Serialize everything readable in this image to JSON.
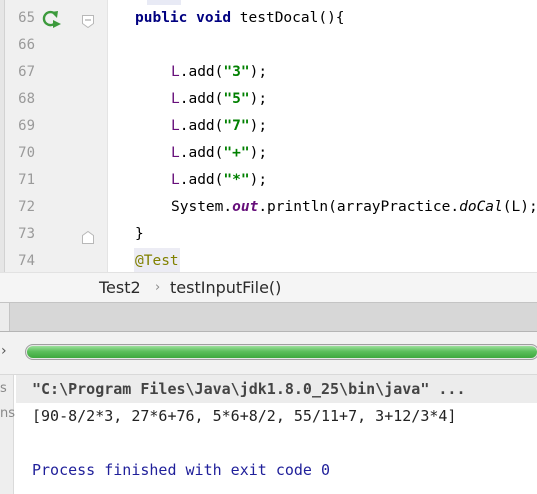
{
  "editor": {
    "lines": [
      {
        "num": "65"
      },
      {
        "num": "66"
      },
      {
        "num": "67"
      },
      {
        "num": "68"
      },
      {
        "num": "69"
      },
      {
        "num": "70"
      },
      {
        "num": "71"
      },
      {
        "num": "72"
      },
      {
        "num": "73"
      },
      {
        "num": "74"
      }
    ],
    "code": {
      "l65": {
        "kw1": "public",
        "kw2": "void",
        "rest": " testDocal(){"
      },
      "l67": {
        "var": "L",
        "call": ".add(",
        "str": "\"3\"",
        "end": ");"
      },
      "l68": {
        "var": "L",
        "call": ".add(",
        "str": "\"5\"",
        "end": ");"
      },
      "l69": {
        "var": "L",
        "call": ".add(",
        "str": "\"7\"",
        "end": ");"
      },
      "l70": {
        "var": "L",
        "call": ".add(",
        "str": "\"+\"",
        "end": ");"
      },
      "l71": {
        "var": "L",
        "call": ".add(",
        "str": "\"*\"",
        "end": ");"
      },
      "l72": {
        "a": "System.",
        "out": "out",
        "b": ".println(arrayPractice.",
        "fn": "doCal",
        "c": "(L);"
      },
      "l73": {
        "text": "}"
      },
      "l74": {
        "text": "@Test"
      }
    },
    "icons": {
      "run_gutter": "run-test-icon",
      "fold": "fold-marker-icon"
    }
  },
  "breadcrumb": {
    "class_name": "Test2",
    "separator": "›",
    "method_name": "testInputFile()"
  },
  "run_panel": {
    "expand_arrow": "›",
    "progress": 1.0,
    "progress_color": "#4cb84c",
    "strip_labels": [
      "s",
      "ns"
    ]
  },
  "console": {
    "command": "\"C:\\Program Files\\Java\\jdk1.8.0_25\\bin\\java\" ...",
    "output": "[90-8/2*3, 27*6+76, 5*6+8/2, 55/11+7, 3+12/3*4]",
    "exit_message": "Process finished with exit code 0"
  },
  "colors": {
    "keyword": "#000080",
    "string": "#008000",
    "field": "#660e7a",
    "annotation": "#808000"
  }
}
